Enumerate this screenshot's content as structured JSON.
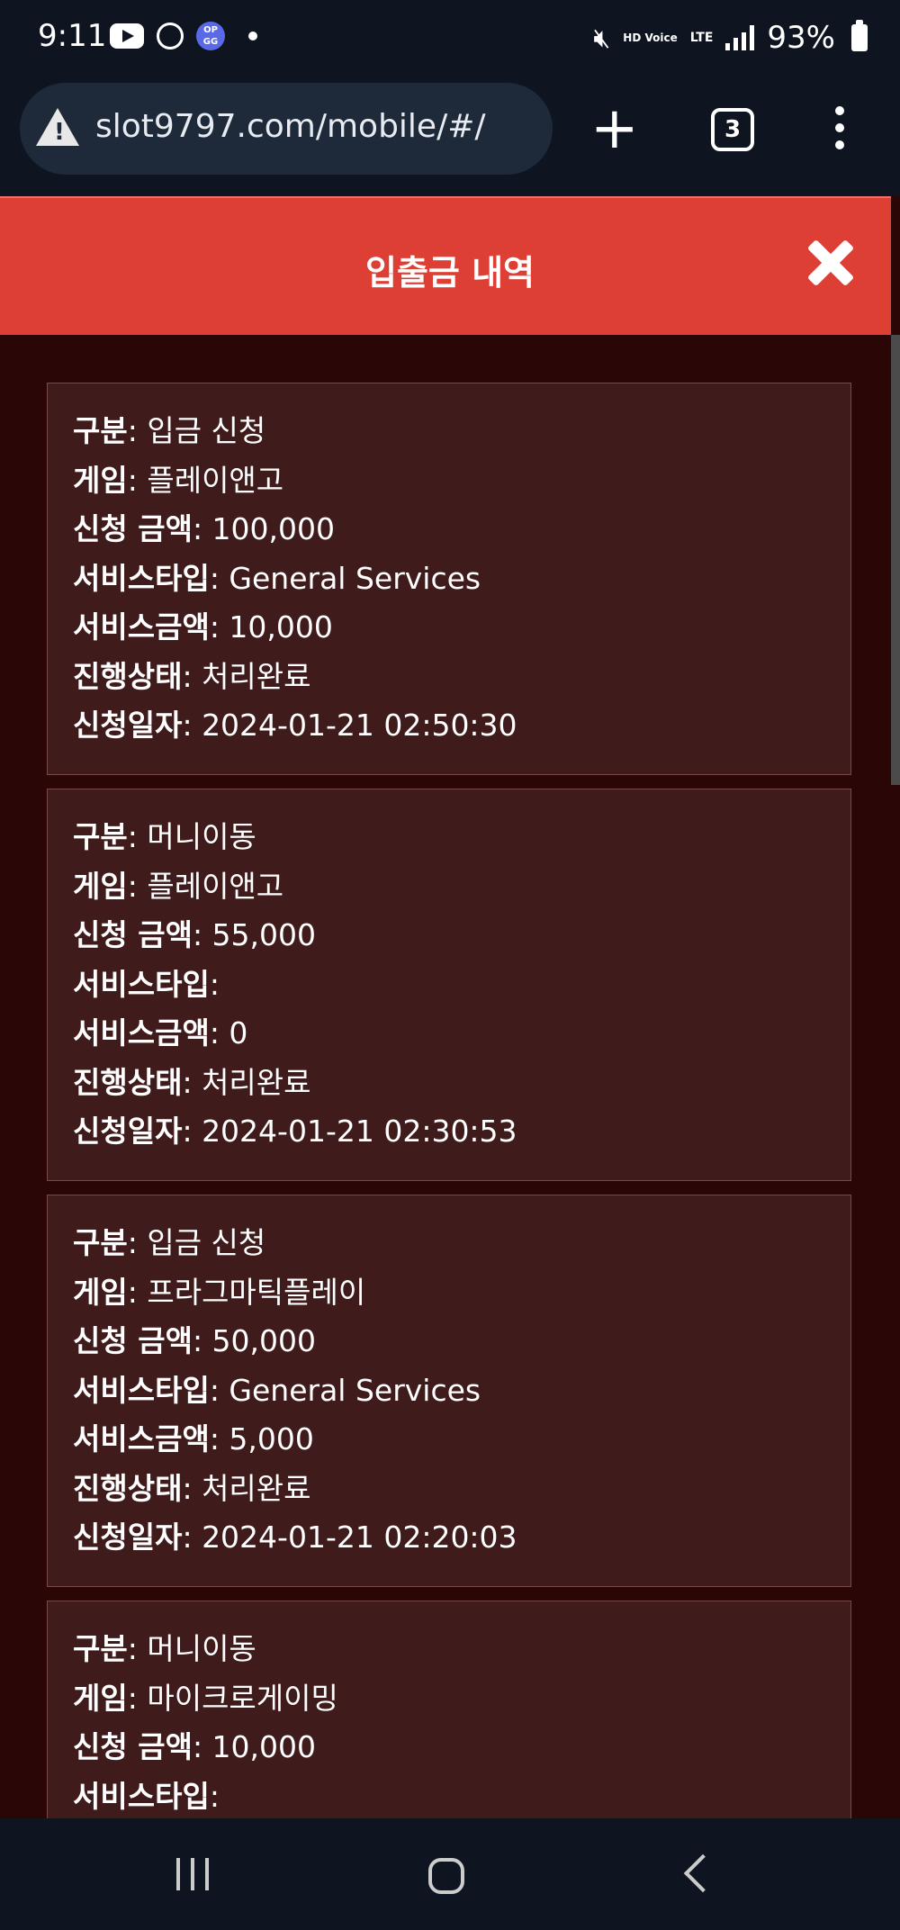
{
  "status_bar": {
    "time": "9:11",
    "app_icons": [
      "youtube-icon",
      "heart-app-icon",
      "opgg-icon"
    ],
    "opgg_label": "OP GG",
    "hd_label": "HD Voice",
    "lte_label": "LTE",
    "battery": "93%"
  },
  "browser": {
    "url": "slot9797.com/mobile/#/",
    "tab_count": "3"
  },
  "header": {
    "title": "입출금 내역"
  },
  "labels": {
    "type": "구분",
    "game": "게임",
    "amount": "신청 금액",
    "service_type": "서비스타입",
    "service_amount": "서비스금액",
    "status": "진행상태",
    "date": "신청일자"
  },
  "records": [
    {
      "type": "입금 신청",
      "game": "플레이앤고",
      "amount": "100,000",
      "service_type": "General Services",
      "service_amount": "10,000",
      "status": "처리완료",
      "date": "2024-01-21 02:50:30"
    },
    {
      "type": "머니이동",
      "game": "플레이앤고",
      "amount": "55,000",
      "service_type": "",
      "service_amount": "0",
      "status": "처리완료",
      "date": "2024-01-21 02:30:53"
    },
    {
      "type": "입금 신청",
      "game": "프라그마틱플레이",
      "amount": "50,000",
      "service_type": "General Services",
      "service_amount": "5,000",
      "status": "처리완료",
      "date": "2024-01-21 02:20:03"
    },
    {
      "type": "머니이동",
      "game": "마이크로게이밍",
      "amount": "10,000",
      "service_type": "",
      "service_amount": "",
      "status": "",
      "date": ""
    }
  ],
  "colors": {
    "header_red": "#dd3f34",
    "background": "#2a0606",
    "card": "#3f1b1c",
    "system_bar": "#0e1420"
  }
}
